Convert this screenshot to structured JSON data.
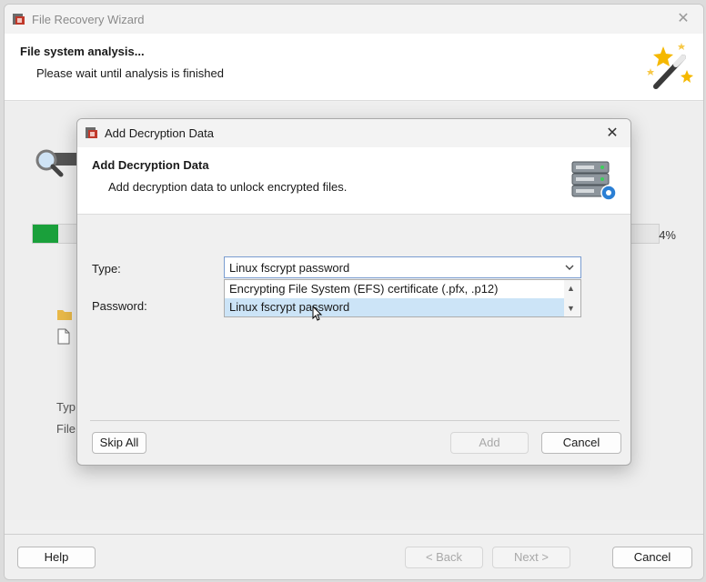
{
  "wizard": {
    "title": "File Recovery Wizard",
    "header_title": "File system analysis...",
    "header_subtitle": "Please wait until analysis is finished",
    "progress_percent": 4,
    "progress_label": "4%",
    "body_type_label": "Typ",
    "body_file_label": "File",
    "buttons": {
      "help": "Help",
      "back": "< Back",
      "next": "Next >",
      "cancel": "Cancel"
    },
    "icons": [
      "app-icon",
      "magic-wand-icon",
      "magnifier-icon",
      "folder-icon",
      "file-icon",
      "close-icon"
    ]
  },
  "dialog": {
    "title": "Add Decryption Data",
    "header_title": "Add Decryption Data",
    "header_subtitle": "Add decryption data to unlock encrypted files.",
    "type_label": "Type:",
    "password_label": "Password:",
    "type_selected": "Linux fscrypt password",
    "type_options": [
      "Encrypting File System (EFS) certificate (.pfx, .p12)",
      "Linux fscrypt password"
    ],
    "highlighted_option_index": 1,
    "buttons": {
      "skip_all": "Skip All",
      "add": "Add",
      "cancel": "Cancel"
    },
    "icons": [
      "server-key-icon",
      "chevron-down-icon",
      "scroll-up-icon",
      "scroll-down-icon",
      "mouse-cursor-icon"
    ]
  },
  "colors": {
    "progress_fill": "#1aa03b",
    "selection_highlight": "#cce4f7",
    "focus_border": "#7a9cd0"
  }
}
